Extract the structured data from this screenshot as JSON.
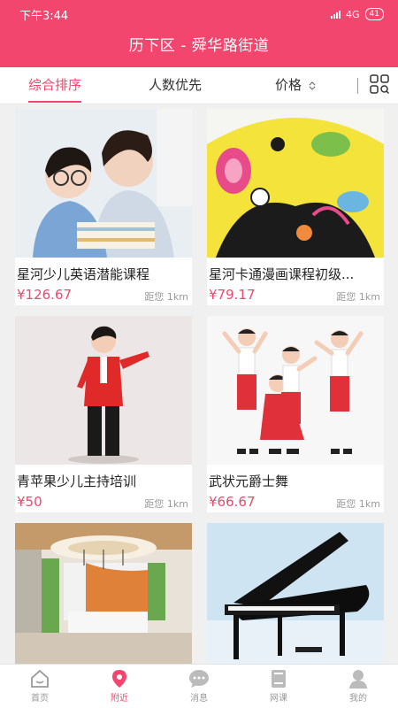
{
  "status": {
    "time": "下午3:44",
    "network": "4G",
    "battery": "41"
  },
  "header": {
    "title": "历下区 - 舜华路街道"
  },
  "filters": {
    "comprehensive": "综合排序",
    "popularity": "人数优先",
    "price": "价格"
  },
  "courses": [
    {
      "name": "星河少儿英语潜能课程",
      "price": "¥126.67",
      "distance": "距您 1km"
    },
    {
      "name": "星河卡通漫画课程初级...",
      "price": "¥79.17",
      "distance": "距您 1km"
    },
    {
      "name": "青苹果少儿主持培训",
      "price": "¥50",
      "distance": "距您 1km"
    },
    {
      "name": "武状元爵士舞",
      "price": "¥66.67",
      "distance": "距您 1km"
    },
    {
      "name": "",
      "price": "",
      "distance": ""
    },
    {
      "name": "",
      "price": "",
      "distance": ""
    }
  ],
  "tabs": {
    "home": "首页",
    "nearby": "附近",
    "messages": "消息",
    "online": "网课",
    "mine": "我的"
  },
  "colors": {
    "accent": "#f2466e"
  },
  "icons": [
    "signal-icon",
    "battery-icon",
    "sort-icon",
    "grid-icon",
    "home-icon",
    "location-icon",
    "message-icon",
    "book-icon",
    "user-icon"
  ]
}
